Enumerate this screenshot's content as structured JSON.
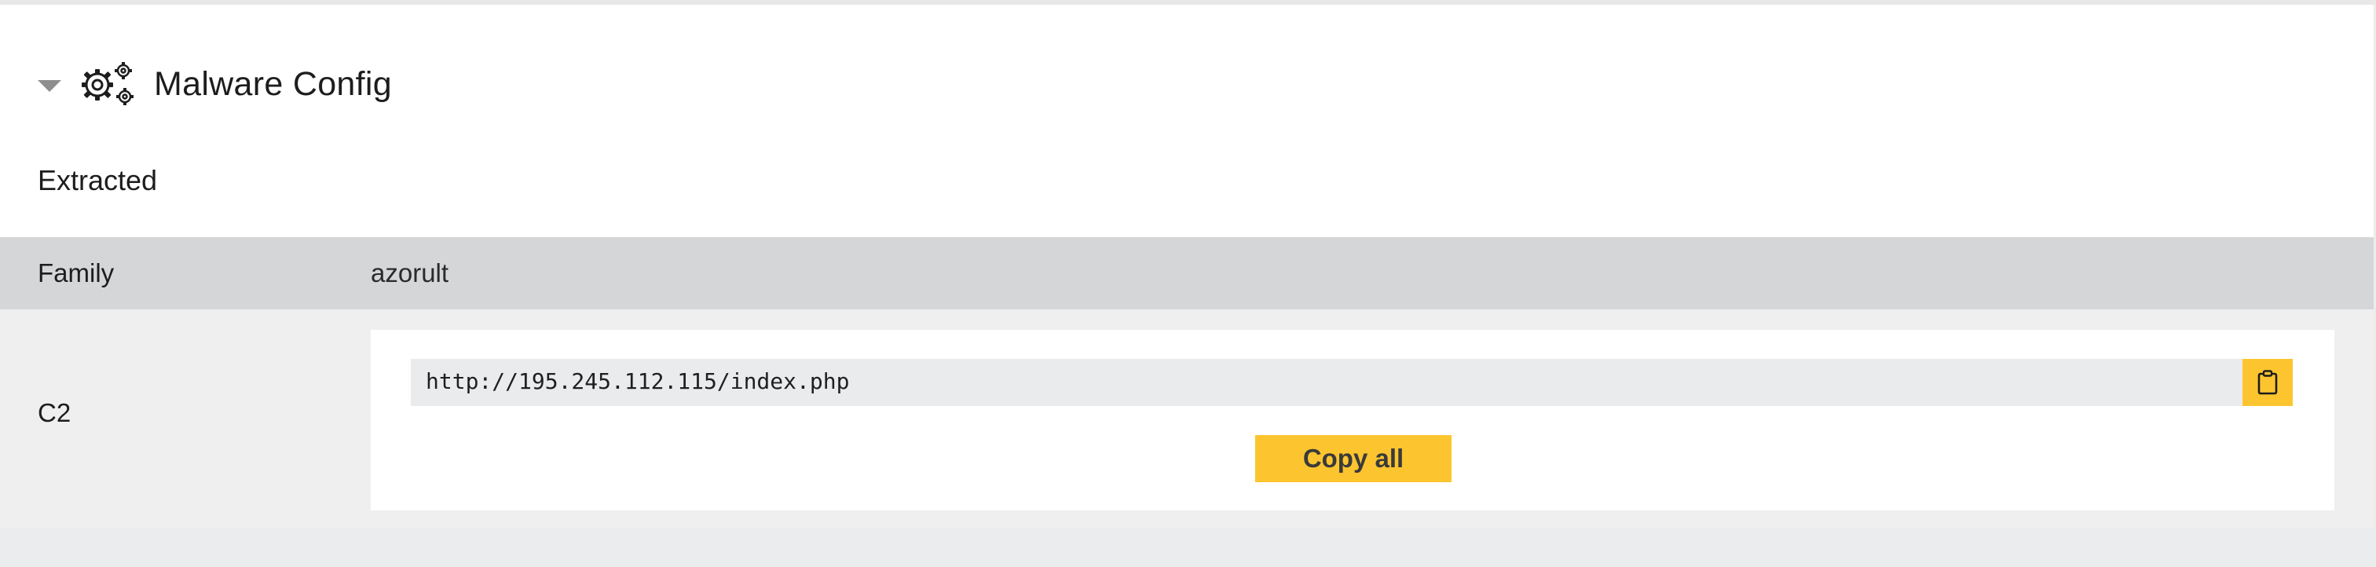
{
  "section": {
    "title": "Malware Config",
    "toggle_icon": "caret-down-icon",
    "icon": "gears-icon"
  },
  "subheading": "Extracted",
  "rows": {
    "family": {
      "label": "Family",
      "value": "azorult"
    },
    "c2": {
      "label": "C2",
      "entries": [
        "http://195.245.112.115/index.php"
      ],
      "copy_icon": "clipboard-icon",
      "copy_all_label": "Copy all"
    }
  },
  "colors": {
    "accent": "#fcc52f",
    "family_row_bg": "#d5d6d8",
    "c2_row_bg": "#efefef",
    "code_bg": "#eaebed"
  }
}
